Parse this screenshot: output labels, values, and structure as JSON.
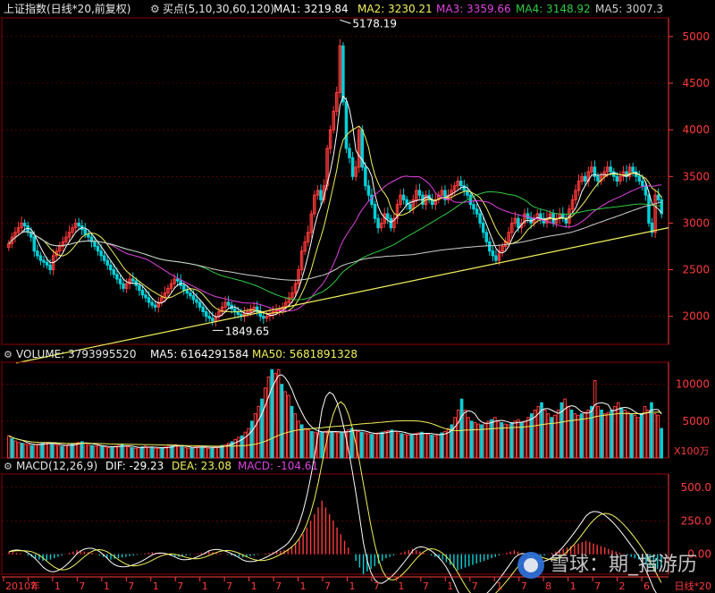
{
  "header": {
    "title": "上证指数(日线*20,前复权)",
    "indicator": "买点(5,10,30,60,120)",
    "ma_readouts": [
      {
        "label": "MA1: 3219.84",
        "color": "#ffffff"
      },
      {
        "label": "MA2: 3230.21",
        "color": "#f2f25a"
      },
      {
        "label": "MA3: 3359.66",
        "color": "#e040e0"
      },
      {
        "label": "MA4: 3148.92",
        "color": "#2ecc40"
      },
      {
        "label": "MA5: 3007.3",
        "color": "#cfcfcf"
      }
    ]
  },
  "volume_header": {
    "label": "VOLUME: 3793995520",
    "ma5": "MA5: 6164291584",
    "ma50": "MA50: 5681891328"
  },
  "macd_header": {
    "label": "MACD(12,26,9)",
    "dif": "DIF: -29.23",
    "dea": "DEA: 23.08",
    "macd": "MACD: -104.61"
  },
  "x_axis": {
    "labels": [
      "2010年",
      "7",
      "1",
      "7",
      "1",
      "7",
      "1",
      "7",
      "1",
      "7",
      "1",
      "7",
      "1",
      "7",
      "1",
      "7",
      "1",
      "7",
      "1",
      "7",
      "1",
      "7",
      "8",
      "1",
      "7",
      "2",
      "6"
    ],
    "period_label": "日线*20"
  },
  "watermark": {
    "text": "雪球：期_指游历"
  },
  "colors": {
    "up": "#ff3b3b",
    "down": "#00d0d8",
    "grid": "#8b0000",
    "axis_text": "#ff3b3b",
    "ma1": "#ffffff",
    "ma2": "#f2f25a",
    "ma3": "#e040e0",
    "ma4": "#2ecc40",
    "ma5": "#cfcfcf",
    "trendline": "#f2f25a",
    "dea": "#f2f25a"
  },
  "chart_data": [
    {
      "type": "candlestick",
      "title": "上证指数(日线*20,前复权)",
      "ylim": [
        1700,
        5200
      ],
      "y_ticks": [
        2000,
        2500,
        3000,
        3500,
        4000,
        4500,
        5000
      ],
      "annotations": [
        {
          "label": "5178.19",
          "value": 5178.19
        },
        {
          "label": "1849.65",
          "value": 1849.65
        }
      ],
      "close": [
        2780,
        2850,
        2900,
        2950,
        3000,
        2970,
        2900,
        2850,
        2700,
        2650,
        2600,
        2580,
        2550,
        2500,
        2650,
        2700,
        2750,
        2800,
        2850,
        2900,
        2950,
        3000,
        2970,
        2930,
        2880,
        2850,
        2800,
        2750,
        2700,
        2650,
        2600,
        2550,
        2500,
        2450,
        2400,
        2350,
        2300,
        2350,
        2400,
        2380,
        2330,
        2280,
        2230,
        2200,
        2150,
        2120,
        2100,
        2150,
        2200,
        2250,
        2300,
        2350,
        2400,
        2380,
        2330,
        2280,
        2250,
        2220,
        2180,
        2150,
        2100,
        2050,
        2000,
        1980,
        1950,
        2000,
        2050,
        2100,
        2150,
        2120,
        2080,
        2050,
        2020,
        2000,
        2030,
        2050,
        2080,
        2100,
        2050,
        2000,
        1980,
        2000,
        2030,
        2050,
        2060,
        2080,
        2100,
        2150,
        2200,
        2250,
        2350,
        2500,
        2700,
        2800,
        2900,
        3100,
        3300,
        3350,
        3250,
        3400,
        3800,
        4000,
        4200,
        4400,
        4900,
        4300,
        3800,
        3700,
        3500,
        3600,
        4000,
        3600,
        3400,
        3300,
        3200,
        3050,
        2950,
        3000,
        3100,
        3050,
        2950,
        3050,
        3200,
        3300,
        3250,
        3200,
        3150,
        3250,
        3350,
        3300,
        3200,
        3300,
        3250,
        3200,
        3250,
        3300,
        3350,
        3250,
        3300,
        3350,
        3400,
        3450,
        3400,
        3350,
        3300,
        3200,
        3150,
        3100,
        3000,
        2900,
        2800,
        2700,
        2650,
        2600,
        2700,
        2750,
        2800,
        2900,
        3000,
        3050,
        2950,
        3000,
        3100,
        3050,
        3000,
        3050,
        3100,
        3050,
        3000,
        3050,
        3100,
        3000,
        3050,
        3100,
        3050,
        3000,
        3150,
        3250,
        3350,
        3450,
        3500,
        3450,
        3550,
        3600,
        3500,
        3450,
        3500,
        3550,
        3600,
        3550,
        3500,
        3450,
        3500,
        3550,
        3500,
        3600,
        3550,
        3500,
        3450,
        3400,
        3300,
        3000,
        2900,
        3300,
        3250,
        3100
      ],
      "series": [
        {
          "name": "MA1",
          "value": 3219.84
        },
        {
          "name": "MA2",
          "value": 3230.21
        },
        {
          "name": "MA3",
          "value": 3359.66
        },
        {
          "name": "MA4",
          "value": 3148.92
        },
        {
          "name": "MA5",
          "value": 3007.3
        }
      ],
      "trendline": {
        "from": 1500,
        "to": 2950
      }
    },
    {
      "type": "bar",
      "title": "VOLUME",
      "unit": "X100万",
      "ylim": [
        0,
        13000
      ],
      "y_ticks": [
        5000,
        10000
      ],
      "values": [
        3000,
        2600,
        2300,
        2100,
        2000,
        1900,
        1800,
        1700,
        1800,
        1900,
        2000,
        2100,
        2000,
        1900,
        1800,
        1700,
        1600,
        1700,
        1800,
        1900,
        2000,
        2100,
        2200,
        2000,
        1800,
        1700,
        1600,
        1700,
        1600,
        1500,
        1400,
        1500,
        1600,
        1700,
        1800,
        1600,
        1500,
        1400,
        1300,
        1400,
        1500,
        1600,
        1500,
        1400,
        1300,
        1300,
        1400,
        1500,
        1600,
        1700,
        1800,
        1600,
        1500,
        1400,
        1300,
        1400,
        1500,
        1600,
        1500,
        1400,
        1300,
        1400,
        1500,
        1600,
        1700,
        1800,
        2000,
        2200,
        2500,
        2800,
        3000,
        3500,
        4000,
        5000,
        6000,
        7000,
        8000,
        9500,
        11000,
        12000,
        11500,
        12000,
        10000,
        9000,
        8500,
        7000,
        6000,
        5000,
        4500,
        4000,
        3800,
        3600,
        3500,
        3400,
        3500,
        3600,
        3700,
        3600,
        3500,
        3400,
        3500,
        3600,
        3800,
        4000,
        3800,
        3600,
        3500,
        3400,
        3300,
        3200,
        3300,
        3400,
        3500,
        3600,
        3700,
        3800,
        3600,
        3400,
        3300,
        3200,
        3100,
        3200,
        3300,
        3400,
        3500,
        3300,
        3200,
        3100,
        3000,
        3200,
        3400,
        3600,
        4000,
        4500,
        5500,
        6500,
        8000,
        6500,
        5500,
        5000,
        4800,
        4600,
        4500,
        4700,
        5000,
        5200,
        5500,
        5000,
        4800,
        4600,
        4500,
        4800,
        5000,
        5200,
        4800,
        5000,
        5500,
        6000,
        6500,
        7000,
        7500,
        6500,
        6000,
        5500,
        5800,
        6500,
        7500,
        8000,
        7000,
        6500,
        6000,
        5800,
        6000,
        6200,
        6500,
        7000,
        10500,
        7000,
        6500,
        6000,
        6200,
        6500,
        7000,
        7500,
        6800,
        6500,
        6200,
        6000,
        5800,
        5500,
        6000,
        7000,
        6500,
        7500,
        6000,
        5800,
        4000
      ],
      "series": [
        {
          "name": "MA5",
          "value": 6164291584
        },
        {
          "name": "MA50",
          "value": 5681891328
        }
      ]
    },
    {
      "type": "bar",
      "title": "MACD(12,26,9)",
      "ylim": [
        -150,
        600
      ],
      "y_ticks": [
        0.0,
        250.0,
        500.0
      ],
      "y_tick_labels": [
        "0.00",
        "250.0",
        "500.0"
      ],
      "values": [
        20,
        15,
        10,
        5,
        0,
        -10,
        -20,
        -30,
        -40,
        -50,
        -45,
        -40,
        -30,
        -20,
        -10,
        0,
        10,
        20,
        30,
        25,
        20,
        15,
        10,
        0,
        -10,
        -20,
        -30,
        -40,
        -35,
        -30,
        -25,
        -20,
        -15,
        -10,
        -5,
        0,
        5,
        10,
        15,
        10,
        5,
        0,
        -5,
        -10,
        -15,
        -20,
        -15,
        -10,
        -5,
        0,
        5,
        10,
        15,
        20,
        15,
        10,
        5,
        0,
        -5,
        -10,
        -15,
        -20,
        -25,
        -20,
        -15,
        -10,
        -5,
        0,
        5,
        10,
        15,
        20,
        25,
        30,
        40,
        60,
        80,
        110,
        150,
        200,
        250,
        300,
        350,
        400,
        350,
        300,
        250,
        200,
        150,
        100,
        50,
        0,
        -50,
        -100,
        -150,
        -130,
        -110,
        -90,
        -70,
        -50,
        -30,
        -20,
        -10,
        0,
        10,
        20,
        30,
        40,
        30,
        20,
        10,
        0,
        -10,
        -20,
        -30,
        -40,
        -60,
        -80,
        -100,
        -120,
        -110,
        -100,
        -90,
        -80,
        -70,
        -60,
        -50,
        -40,
        -30,
        -20,
        -10,
        0,
        10,
        20,
        30,
        20,
        10,
        0,
        -10,
        -20,
        -30,
        -20,
        -10,
        0,
        10,
        20,
        30,
        40,
        50,
        60,
        70,
        80,
        90,
        100,
        90,
        80,
        70,
        60,
        50,
        40,
        30,
        20,
        10,
        0,
        -10,
        -20,
        -30,
        -40,
        -60,
        -80,
        -100,
        -120,
        -110,
        -100
      ],
      "series": [
        {
          "name": "DIF",
          "value": -29.23
        },
        {
          "name": "DEA",
          "value": 23.08
        },
        {
          "name": "MACD",
          "value": -104.61
        }
      ]
    }
  ]
}
